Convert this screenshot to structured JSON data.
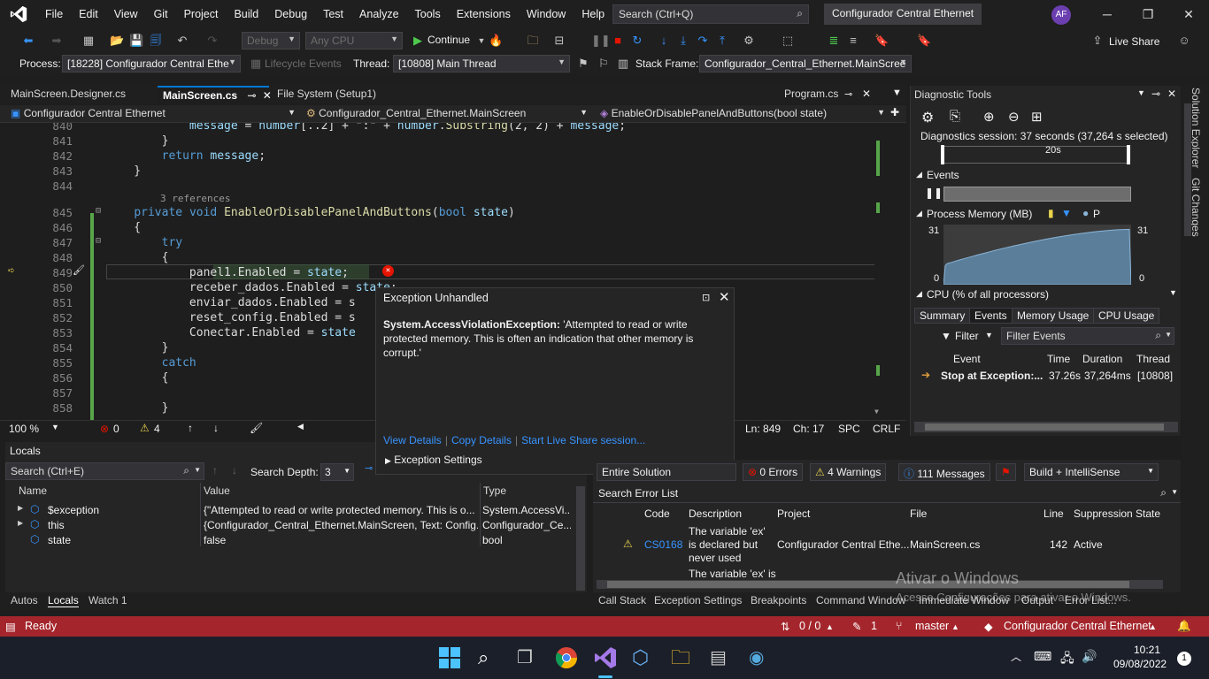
{
  "menu": [
    "File",
    "Edit",
    "View",
    "Git",
    "Project",
    "Build",
    "Debug",
    "Test",
    "Analyze",
    "Tools",
    "Extensions",
    "Window",
    "Help"
  ],
  "search": {
    "placeholder": "Search (Ctrl+Q)"
  },
  "window_title": "Configurador Central Ethernet",
  "avatar": "AF",
  "toolbar1": {
    "config": "Debug",
    "platform": "Any CPU",
    "continue": "Continue",
    "live_share": "Live Share"
  },
  "toolbar2": {
    "process_label": "Process:",
    "process_value": "[18228] Configurador Central Ethe",
    "lifecycle": "Lifecycle Events",
    "thread_label": "Thread:",
    "thread_value": "[10808] Main Thread",
    "stackframe_label": "Stack Frame:",
    "stackframe_value": "Configurador_Central_Ethernet.MainScree"
  },
  "doc_tabs": [
    "MainScreen.Designer.cs",
    "MainScreen.cs",
    "File System (Setup1)",
    "Program.cs"
  ],
  "nav": {
    "project": "Configurador Central Ethernet",
    "class": "Configurador_Central_Ethernet.MainScreen",
    "member": "EnableOrDisablePanelAndButtons(bool state)"
  },
  "code": {
    "lines": [
      {
        "n": "840",
        "text": "            message = number[..2] + \":\" + number.Substring(2, 2) + message;"
      },
      {
        "n": "841",
        "text": "        }"
      },
      {
        "n": "842",
        "text": "        return message;"
      },
      {
        "n": "843",
        "text": "    }"
      },
      {
        "n": "844",
        "text": ""
      },
      {
        "n": "845",
        "text": "    private void EnableOrDisablePanelAndButtons(bool state)"
      },
      {
        "n": "846",
        "text": "    {"
      },
      {
        "n": "847",
        "text": "        try"
      },
      {
        "n": "848",
        "text": "        {"
      },
      {
        "n": "849",
        "text": "            panel1.Enabled = state;"
      },
      {
        "n": "850",
        "text": "            receber_dados.Enabled = state;"
      },
      {
        "n": "851",
        "text": "            enviar_dados.Enabled = s"
      },
      {
        "n": "852",
        "text": "            reset_config.Enabled = s"
      },
      {
        "n": "853",
        "text": "            Conectar.Enabled = state"
      },
      {
        "n": "854",
        "text": "        }"
      },
      {
        "n": "855",
        "text": "        catch"
      },
      {
        "n": "856",
        "text": "        {"
      },
      {
        "n": "857",
        "text": ""
      },
      {
        "n": "858",
        "text": "        }"
      }
    ],
    "references": "3 references"
  },
  "editor_status": {
    "zoom": "100 %",
    "errors": "0",
    "warnings": "4",
    "line": "Ln: 849",
    "col": "Ch: 17",
    "spc": "SPC",
    "crlf": "CRLF"
  },
  "exception": {
    "title": "Exception Unhandled",
    "type": "System.AccessViolationException:",
    "message": "'Attempted to read or write protected memory. This is often an indication that other memory is corrupt.'",
    "links": [
      "View Details",
      "Copy Details",
      "Start Live Share session..."
    ],
    "settings": "Exception Settings"
  },
  "diagnostics": {
    "title": "Diagnostic Tools",
    "session": "Diagnostics session: 37 seconds (37,264 s selected)",
    "timeline_tick": "20s",
    "events_label": "Events",
    "memory_label": "Process Memory (MB)",
    "memory_legend_p": "P",
    "memory_max": "31",
    "memory_min": "0",
    "cpu_label": "CPU (% of all processors)",
    "tabs": [
      "Summary",
      "Events",
      "Memory Usage",
      "CPU Usage"
    ],
    "filter": "Filter",
    "filter_placeholder": "Filter Events",
    "columns": [
      "Event",
      "Time",
      "Duration",
      "Thread"
    ],
    "row": {
      "event": "Stop at Exception:...",
      "time": "37.26s",
      "duration": "37,264ms",
      "thread": "[10808]"
    },
    "memory_fraction_start": 0.35,
    "memory_fraction_end": 0.92
  },
  "side_strip": [
    "Solution Explorer",
    "Git Changes"
  ],
  "locals": {
    "title": "Locals",
    "search_placeholder": "Search (Ctrl+E)",
    "search_depth_label": "Search Depth:",
    "search_depth": "3",
    "columns": [
      "Name",
      "Value",
      "Type"
    ],
    "rows": [
      {
        "name": "$exception",
        "value": "{\"Attempted to read or write protected memory. This is o...",
        "type": "System.AccessVi..."
      },
      {
        "name": "this",
        "value": "{Configurador_Central_Ethernet.MainScreen, Text: Config...",
        "type": "Configurador_Ce..."
      },
      {
        "name": "state",
        "value": "false",
        "type": "bool"
      }
    ]
  },
  "error_list": {
    "scope": "Entire Solution",
    "errors": "0 Errors",
    "warnings": "4 Warnings",
    "messages": "111 Messages",
    "build": "Build + IntelliSense",
    "search_placeholder": "Search Error List",
    "columns": [
      "Code",
      "Description",
      "Project",
      "File",
      "Line",
      "Suppression State"
    ],
    "rows": [
      {
        "code": "CS0168",
        "description": "The variable 'ex' is declared but never used",
        "project": "Configurador Central Ethe...",
        "file": "MainScreen.cs",
        "line": "142",
        "state": "Active"
      },
      {
        "code": "",
        "description": "The variable 'ex' is",
        "project": "",
        "file": "",
        "line": "",
        "state": ""
      }
    ]
  },
  "bottom_tabs_left": [
    "Autos",
    "Locals",
    "Watch 1"
  ],
  "bottom_tabs_right": [
    "Call Stack",
    "Exception Settings",
    "Breakpoints",
    "Command Window",
    "Immediate Window",
    "Output",
    "Error List..."
  ],
  "watermark": {
    "line1": "Ativar o Windows",
    "line2": "Acesse Configurações para ativar o Windows."
  },
  "statusbar": {
    "ready": "Ready",
    "git_counts": "0 / 0",
    "pencil_count": "1",
    "branch": "master",
    "repo": "Configurador Central Ethernet"
  },
  "taskbar": {
    "time": "10:21",
    "date": "09/08/2022",
    "notif": "1"
  },
  "colors": {
    "statusbar": "#a4262c",
    "accent": "#0078d4",
    "link": "#3794ff"
  }
}
